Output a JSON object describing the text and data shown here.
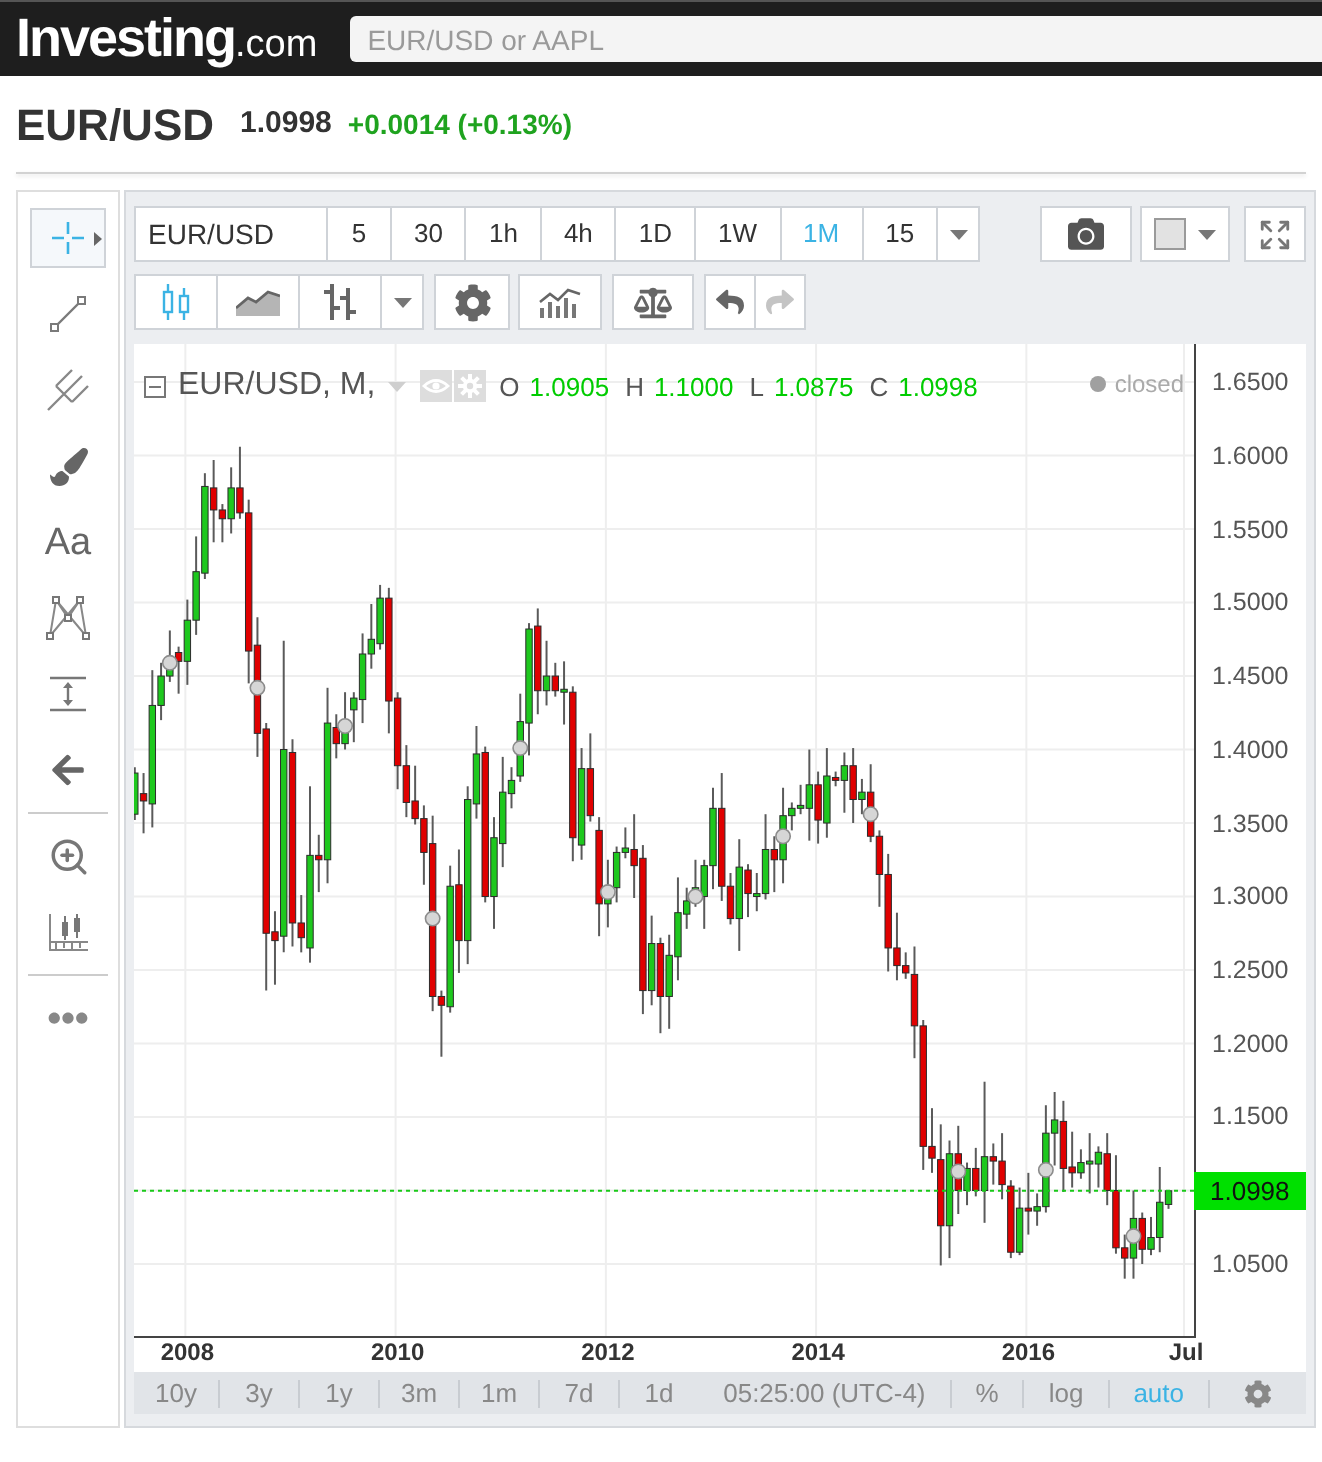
{
  "header": {
    "logo": {
      "name": "Investing",
      "suffix": ".com"
    },
    "search": {
      "placeholder": "EUR/USD or AAPL"
    }
  },
  "quote": {
    "symbol": "EUR/USD",
    "price": "1.0998",
    "change": "+0.0014 (+0.13%)"
  },
  "tool_groups": [
    {
      "tools": [
        {
          "kind": "crosshair",
          "selected": true
        },
        {
          "kind": "trend-line",
          "selected": false
        },
        {
          "kind": "pitchfork",
          "selected": false
        },
        {
          "kind": "brush",
          "selected": false
        },
        {
          "kind": "text",
          "label": "Aa",
          "selected": false
        },
        {
          "kind": "pattern",
          "selected": false
        },
        {
          "kind": "measure",
          "selected": false
        },
        {
          "kind": "arrow",
          "selected": false
        }
      ]
    },
    {
      "tools": [
        {
          "kind": "zoom",
          "selected": false
        },
        {
          "kind": "ruler",
          "selected": false
        }
      ]
    },
    {
      "tools": [
        {
          "kind": "more",
          "selected": false
        }
      ]
    }
  ],
  "toolbar": {
    "symbol": "EUR/USD",
    "intervals": [
      {
        "label": "5",
        "selected": false
      },
      {
        "label": "30",
        "selected": false
      },
      {
        "label": "1h",
        "selected": false
      },
      {
        "label": "4h",
        "selected": false
      },
      {
        "label": "1D",
        "selected": false
      },
      {
        "label": "1W",
        "selected": false
      },
      {
        "label": "1M",
        "selected": true
      },
      {
        "label": "15",
        "selected": false
      }
    ]
  },
  "chart_styles": [
    {
      "kind": "candles",
      "selected": true
    },
    {
      "kind": "area",
      "selected": false
    },
    {
      "kind": "bars",
      "selected": false
    }
  ],
  "history": [
    {
      "kind": "undo",
      "disabled": false
    },
    {
      "kind": "redo",
      "disabled": true
    }
  ],
  "chart": {
    "legend": {
      "title": "EUR/USD, M,",
      "values": [
        {
          "key": "O",
          "value": "1.0905"
        },
        {
          "key": "H",
          "value": "1.1000"
        },
        {
          "key": "L",
          "value": "1.0875"
        },
        {
          "key": "C",
          "value": "1.0998"
        }
      ]
    },
    "status": "closed",
    "chart_data": {
      "type": "candlestick",
      "x": [
        "2007-07",
        "2007-08",
        "2007-09",
        "2007-10",
        "2007-11",
        "2007-12",
        "2008-01",
        "2008-02",
        "2008-03",
        "2008-04",
        "2008-05",
        "2008-06",
        "2008-07",
        "2008-08",
        "2008-09",
        "2008-10",
        "2008-11",
        "2008-12",
        "2009-01",
        "2009-02",
        "2009-03",
        "2009-04",
        "2009-05",
        "2009-06",
        "2009-07",
        "2009-08",
        "2009-09",
        "2009-10",
        "2009-11",
        "2009-12",
        "2010-01",
        "2010-02",
        "2010-03",
        "2010-04",
        "2010-05",
        "2010-06",
        "2010-07",
        "2010-08",
        "2010-09",
        "2010-10",
        "2010-11",
        "2010-12",
        "2011-01",
        "2011-02",
        "2011-03",
        "2011-04",
        "2011-05",
        "2011-06",
        "2011-07",
        "2011-08",
        "2011-09",
        "2011-10",
        "2011-11",
        "2011-12",
        "2012-01",
        "2012-02",
        "2012-03",
        "2012-04",
        "2012-05",
        "2012-06",
        "2012-07",
        "2012-08",
        "2012-09",
        "2012-10",
        "2012-11",
        "2012-12",
        "2013-01",
        "2013-02",
        "2013-03",
        "2013-04",
        "2013-05",
        "2013-06",
        "2013-07",
        "2013-08",
        "2013-09",
        "2013-10",
        "2013-11",
        "2013-12",
        "2014-01",
        "2014-02",
        "2014-03",
        "2014-04",
        "2014-05",
        "2014-06",
        "2014-07",
        "2014-08",
        "2014-09",
        "2014-10",
        "2014-11",
        "2014-12",
        "2015-01",
        "2015-02",
        "2015-03",
        "2015-04",
        "2015-05",
        "2015-06",
        "2015-07",
        "2015-08",
        "2015-09",
        "2015-10",
        "2015-11",
        "2015-12",
        "2016-01",
        "2016-02",
        "2016-03",
        "2016-04",
        "2016-05",
        "2016-06",
        "2016-07",
        "2016-08",
        "2016-09",
        "2016-10",
        "2016-11",
        "2016-12",
        "2017-01",
        "2017-02",
        "2017-03",
        "2017-04",
        "2017-05"
      ],
      "ohlc": [
        [
          1.356,
          1.388,
          1.352,
          1.384
        ],
        [
          1.37,
          1.384,
          1.343,
          1.365
        ],
        [
          1.363,
          1.454,
          1.347,
          1.43
        ],
        [
          1.43,
          1.459,
          1.42,
          1.45
        ],
        [
          1.45,
          1.481,
          1.446,
          1.462
        ],
        [
          1.466,
          1.47,
          1.438,
          1.46
        ],
        [
          1.46,
          1.502,
          1.444,
          1.488
        ],
        [
          1.488,
          1.545,
          1.478,
          1.521
        ],
        [
          1.52,
          1.588,
          1.516,
          1.579
        ],
        [
          1.578,
          1.597,
          1.541,
          1.563
        ],
        [
          1.563,
          1.567,
          1.541,
          1.557
        ],
        [
          1.557,
          1.592,
          1.547,
          1.578
        ],
        [
          1.578,
          1.606,
          1.557,
          1.561
        ],
        [
          1.561,
          1.57,
          1.445,
          1.467
        ],
        [
          1.471,
          1.49,
          1.395,
          1.411
        ],
        [
          1.414,
          1.418,
          1.236,
          1.275
        ],
        [
          1.276,
          1.29,
          1.24,
          1.27
        ],
        [
          1.273,
          1.474,
          1.262,
          1.4
        ],
        [
          1.398,
          1.407,
          1.266,
          1.282
        ],
        [
          1.282,
          1.301,
          1.262,
          1.272
        ],
        [
          1.265,
          1.375,
          1.255,
          1.328
        ],
        [
          1.328,
          1.342,
          1.303,
          1.325
        ],
        [
          1.325,
          1.442,
          1.309,
          1.418
        ],
        [
          1.415,
          1.424,
          1.394,
          1.404
        ],
        [
          1.404,
          1.439,
          1.4,
          1.42
        ],
        [
          1.427,
          1.439,
          1.405,
          1.435
        ],
        [
          1.434,
          1.479,
          1.418,
          1.465
        ],
        [
          1.465,
          1.499,
          1.455,
          1.475
        ],
        [
          1.472,
          1.512,
          1.468,
          1.503
        ],
        [
          1.503,
          1.51,
          1.411,
          1.433
        ],
        [
          1.435,
          1.439,
          1.373,
          1.389
        ],
        [
          1.389,
          1.403,
          1.354,
          1.364
        ],
        [
          1.365,
          1.389,
          1.349,
          1.353
        ],
        [
          1.353,
          1.362,
          1.308,
          1.33
        ],
        [
          1.336,
          1.355,
          1.222,
          1.232
        ],
        [
          1.232,
          1.236,
          1.191,
          1.226
        ],
        [
          1.225,
          1.321,
          1.221,
          1.307
        ],
        [
          1.308,
          1.332,
          1.248,
          1.27
        ],
        [
          1.27,
          1.375,
          1.254,
          1.366
        ],
        [
          1.363,
          1.416,
          1.353,
          1.397
        ],
        [
          1.398,
          1.402,
          1.296,
          1.3
        ],
        [
          1.3,
          1.354,
          1.278,
          1.34
        ],
        [
          1.336,
          1.395,
          1.32,
          1.371
        ],
        [
          1.37,
          1.388,
          1.36,
          1.379
        ],
        [
          1.382,
          1.438,
          1.378,
          1.419
        ],
        [
          1.418,
          1.486,
          1.396,
          1.482
        ],
        [
          1.484,
          1.496,
          1.424,
          1.44
        ],
        [
          1.44,
          1.474,
          1.43,
          1.45
        ],
        [
          1.45,
          1.459,
          1.436,
          1.44
        ],
        [
          1.439,
          1.46,
          1.417,
          1.441
        ],
        [
          1.439,
          1.443,
          1.324,
          1.34
        ],
        [
          1.335,
          1.401,
          1.325,
          1.387
        ],
        [
          1.387,
          1.411,
          1.351,
          1.355
        ],
        [
          1.345,
          1.354,
          1.273,
          1.295
        ],
        [
          1.295,
          1.325,
          1.279,
          1.306
        ],
        [
          1.306,
          1.334,
          1.296,
          1.33
        ],
        [
          1.33,
          1.347,
          1.326,
          1.333
        ],
        [
          1.332,
          1.356,
          1.299,
          1.321
        ],
        [
          1.326,
          1.335,
          1.22,
          1.236
        ],
        [
          1.236,
          1.287,
          1.226,
          1.268
        ],
        [
          1.268,
          1.272,
          1.207,
          1.232
        ],
        [
          1.232,
          1.274,
          1.21,
          1.26
        ],
        [
          1.259,
          1.313,
          1.243,
          1.289
        ],
        [
          1.288,
          1.306,
          1.278,
          1.297
        ],
        [
          1.297,
          1.325,
          1.293,
          1.306
        ],
        [
          1.3,
          1.325,
          1.278,
          1.321
        ],
        [
          1.321,
          1.374,
          1.305,
          1.36
        ],
        [
          1.36,
          1.384,
          1.297,
          1.307
        ],
        [
          1.307,
          1.316,
          1.281,
          1.285
        ],
        [
          1.285,
          1.339,
          1.263,
          1.32
        ],
        [
          1.318,
          1.322,
          1.286,
          1.302
        ],
        [
          1.3,
          1.316,
          1.29,
          1.302
        ],
        [
          1.302,
          1.356,
          1.298,
          1.332
        ],
        [
          1.332,
          1.341,
          1.303,
          1.325
        ],
        [
          1.325,
          1.374,
          1.309,
          1.355
        ],
        [
          1.355,
          1.364,
          1.345,
          1.36
        ],
        [
          1.36,
          1.376,
          1.356,
          1.362
        ],
        [
          1.36,
          1.4,
          1.338,
          1.376
        ],
        [
          1.376,
          1.385,
          1.336,
          1.352
        ],
        [
          1.35,
          1.401,
          1.34,
          1.382
        ],
        [
          1.381,
          1.385,
          1.375,
          1.379
        ],
        [
          1.379,
          1.398,
          1.357,
          1.389
        ],
        [
          1.389,
          1.401,
          1.35,
          1.366
        ],
        [
          1.366,
          1.38,
          1.356,
          1.371
        ],
        [
          1.371,
          1.39,
          1.337,
          1.341
        ],
        [
          1.341,
          1.345,
          1.293,
          1.315
        ],
        [
          1.315,
          1.329,
          1.249,
          1.265
        ],
        [
          1.265,
          1.289,
          1.243,
          1.253
        ],
        [
          1.253,
          1.262,
          1.244,
          1.248
        ],
        [
          1.247,
          1.266,
          1.19,
          1.212
        ],
        [
          1.212,
          1.216,
          1.114,
          1.13
        ],
        [
          1.13,
          1.156,
          1.112,
          1.122
        ],
        [
          1.121,
          1.145,
          1.049,
          1.076
        ],
        [
          1.076,
          1.134,
          1.054,
          1.125
        ],
        [
          1.125,
          1.144,
          1.084,
          1.1
        ],
        [
          1.1,
          1.119,
          1.09,
          1.115
        ],
        [
          1.115,
          1.129,
          1.096,
          1.1
        ],
        [
          1.1,
          1.174,
          1.078,
          1.123
        ],
        [
          1.123,
          1.132,
          1.104,
          1.12
        ],
        [
          1.12,
          1.139,
          1.094,
          1.104
        ],
        [
          1.103,
          1.107,
          1.054,
          1.058
        ],
        [
          1.058,
          1.102,
          1.056,
          1.088
        ],
        [
          1.088,
          1.112,
          1.07,
          1.086
        ],
        [
          1.086,
          1.098,
          1.076,
          1.089
        ],
        [
          1.089,
          1.158,
          1.085,
          1.139
        ],
        [
          1.139,
          1.167,
          1.117,
          1.148
        ],
        [
          1.147,
          1.161,
          1.099,
          1.115
        ],
        [
          1.116,
          1.14,
          1.102,
          1.112
        ],
        [
          1.112,
          1.128,
          1.108,
          1.119
        ],
        [
          1.118,
          1.139,
          1.098,
          1.12
        ],
        [
          1.118,
          1.13,
          1.102,
          1.126
        ],
        [
          1.125,
          1.139,
          1.09,
          1.1
        ],
        [
          1.1,
          1.124,
          1.057,
          1.061
        ],
        [
          1.061,
          1.07,
          1.04,
          1.054
        ],
        [
          1.054,
          1.1,
          1.04,
          1.081
        ],
        [
          1.081,
          1.085,
          1.05,
          1.06
        ],
        [
          1.06,
          1.082,
          1.056,
          1.068
        ],
        [
          1.068,
          1.116,
          1.058,
          1.092
        ],
        [
          1.0905,
          1.1,
          1.0875,
          1.0998
        ]
      ],
      "xlim": [
        "2007-07",
        "2017-08"
      ],
      "ylim": [
        1.001,
        1.6759
      ],
      "grid": true,
      "yticks": [
        {
          "value": 1.65,
          "label": "1.6500"
        },
        {
          "value": 1.6,
          "label": "1.6000"
        },
        {
          "value": 1.55,
          "label": "1.5500"
        },
        {
          "value": 1.5,
          "label": "1.5000"
        },
        {
          "value": 1.45,
          "label": "1.4500"
        },
        {
          "value": 1.4,
          "label": "1.4000"
        },
        {
          "value": 1.35,
          "label": "1.3500"
        },
        {
          "value": 1.3,
          "label": "1.3000"
        },
        {
          "value": 1.25,
          "label": "1.2500"
        },
        {
          "value": 1.2,
          "label": "1.2000"
        },
        {
          "value": 1.15,
          "label": "1.1500"
        },
        {
          "value": 1.05,
          "label": "1.0500"
        }
      ],
      "xticks": [
        {
          "value": "2008-01",
          "label": "2008"
        },
        {
          "value": "2010-01",
          "label": "2010"
        },
        {
          "value": "2012-01",
          "label": "2012"
        },
        {
          "value": "2014-01",
          "label": "2014"
        },
        {
          "value": "2016-01",
          "label": "2016"
        },
        {
          "value": "2017-07",
          "label": "Jul"
        }
      ],
      "ref_lines": [
        {
          "axis": "y",
          "value": 1.0998,
          "label": "1.0998",
          "color": "#18c918"
        }
      ]
    }
  },
  "bottom_bar": {
    "ranges": [
      "10y",
      "3y",
      "1y",
      "3m",
      "1m",
      "7d",
      "1d"
    ],
    "time": "05:25:00 (UTC-4)",
    "scales": [
      {
        "label": "%",
        "selected": false
      },
      {
        "label": "log",
        "selected": false
      },
      {
        "label": "auto",
        "selected": true
      }
    ]
  }
}
